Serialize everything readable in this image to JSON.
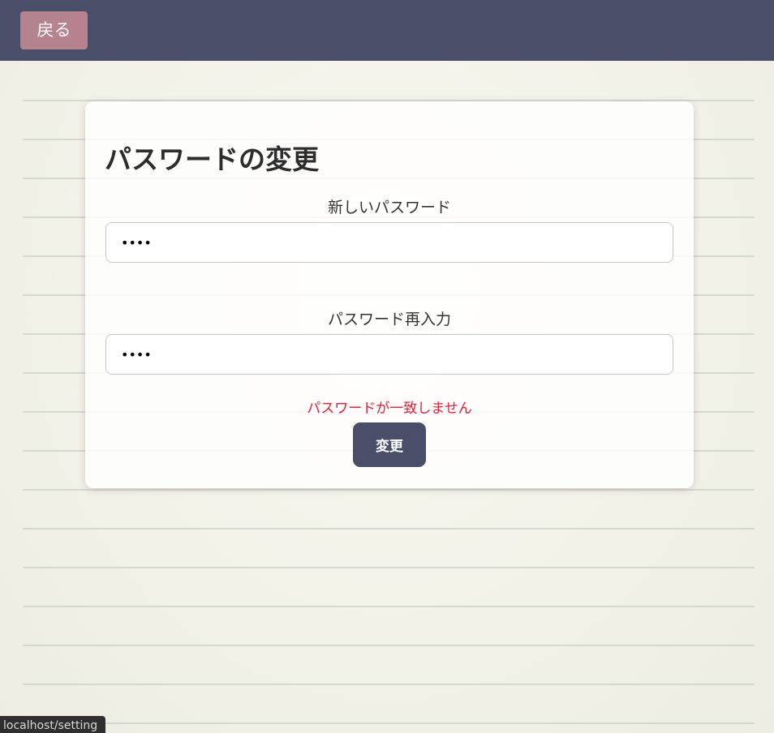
{
  "header": {
    "back_label": "戻る"
  },
  "form": {
    "title": "パスワードの変更",
    "new_password": {
      "label": "新しいパスワード",
      "value": "abcd"
    },
    "confirm_password": {
      "label": "パスワード再入力",
      "value": "abcd"
    },
    "error_message": "パスワードが一致しません",
    "submit_label": "変更"
  },
  "status_bar": {
    "url": "localhost/setting"
  },
  "colors": {
    "header_bg": "#4a4e69",
    "back_button_bg": "#b5838d",
    "submit_button_bg": "#4a4e69",
    "error_text": "#e2203a",
    "page_bg": "#f5f3ea"
  }
}
